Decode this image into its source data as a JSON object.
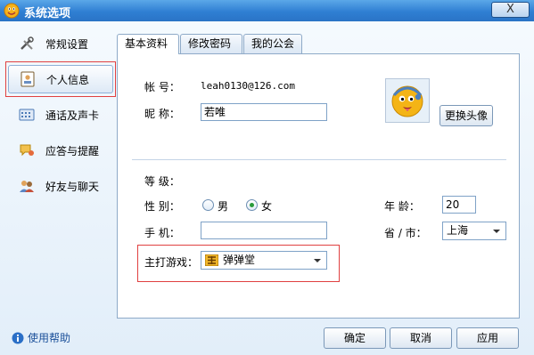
{
  "window": {
    "title": "系统选项",
    "close_glyph": "X"
  },
  "sidebar": {
    "items": [
      {
        "label": "常规设置",
        "icon": "tools-icon"
      },
      {
        "label": "个人信息",
        "icon": "id-card-icon",
        "selected": true
      },
      {
        "label": "通话及声卡",
        "icon": "keyboard-icon"
      },
      {
        "label": "应答与提醒",
        "icon": "chat-icon"
      },
      {
        "label": "好友与聊天",
        "icon": "friends-icon"
      }
    ],
    "help_label": "使用帮助"
  },
  "tabs": [
    {
      "label": "基本资料",
      "active": true
    },
    {
      "label": "修改密码"
    },
    {
      "label": "我的公会"
    }
  ],
  "profile": {
    "account_label": "帐    号：",
    "account_value": "leah0130@126.com",
    "nickname_label": "昵    称：",
    "nickname_value": "若唯",
    "change_avatar": "更换头像",
    "level_label": "等    级：",
    "gender_label": "性    别：",
    "gender_options": [
      "男",
      "女"
    ],
    "gender_selected": "女",
    "age_label": "年    龄：",
    "age_value": "20",
    "phone_label": "手    机：",
    "phone_value": "",
    "province_label": "省 / 市：",
    "province_value": "上海",
    "game_label": "主打游戏：",
    "game_value": "弹弹堂"
  },
  "buttons": {
    "ok": "确定",
    "cancel": "取消",
    "apply": "应用"
  },
  "colors": {
    "title_bar": "#2f7fd3",
    "highlight_red": "#e04040",
    "radio_checked": "#2a9b3a"
  }
}
